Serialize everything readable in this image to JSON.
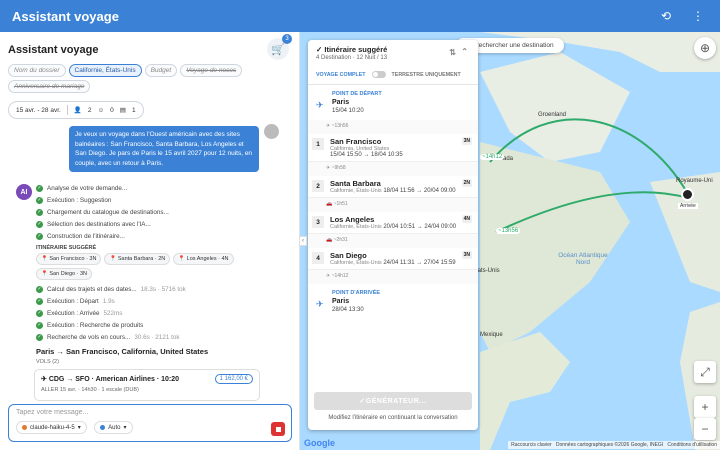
{
  "app": {
    "title": "Assistant voyage"
  },
  "left": {
    "heading": "Assistant voyage",
    "cart_count": "3",
    "chips": [
      {
        "label": "Nom du dossier",
        "state": "placeholder"
      },
      {
        "label": "Californie, États-Unis",
        "state": "selected"
      },
      {
        "label": "Budget",
        "state": "placeholder"
      },
      {
        "label": "Voyage de noces",
        "state": "struck"
      },
      {
        "label": "Anniversaire de mariage",
        "state": "struck"
      }
    ],
    "dates": "15 avr. - 28 avr.",
    "travellers": {
      "adults": "2",
      "children": "0",
      "rooms": "1"
    },
    "user_message": "Je veux un voyage dans l'Ouest américain avec des sites balnéaires : San Francisco, Santa Barbara, Los Angeles et San Diego. Je pars de Paris le 15 avril 2027 pour 12 nuits, en couple, avec un retour à Paris.",
    "ai_avatar": "AI",
    "steps_a": [
      {
        "label": "Analyse de votre demande..."
      },
      {
        "label": "Exécution : Suggestion"
      },
      {
        "label": "Chargement du catalogue de destinations..."
      },
      {
        "label": "Sélection des destinations avec l'IA..."
      },
      {
        "label": "Construction de l'itinéraire..."
      }
    ],
    "suggested_label": "ITINÉRAIRE SUGGÉRÉ",
    "pins": [
      "San Francisco · 3N",
      "Santa Barbara · 2N",
      "Los Angeles · 4N",
      "San Diego · 3N"
    ],
    "steps_b": [
      {
        "label": "Calcul des trajets et des dates...",
        "time": "18.3s · 5716 tok"
      },
      {
        "label": "Exécution : Départ",
        "time": "1.9s"
      },
      {
        "label": "Exécution : Arrivée",
        "time": "522ms"
      },
      {
        "label": "Exécution : Recherche de produits",
        "time": ""
      },
      {
        "label": "Recherche de vols en cours...",
        "time": "30.6s · 2121 tok"
      }
    ],
    "route_title": "Paris → San Francisco, California, United States",
    "vols_label": "VOLS (2)",
    "flight": {
      "title": "CDG → SFO · American Airlines · 10:20",
      "price": "1 162,00 €",
      "detail": "ALLER 15 avr. · 14h30 · 1 escale (DUB)"
    },
    "input_placeholder": "Tapez votre message...",
    "model": "claude-haiku-4-5",
    "mode": "Auto"
  },
  "map": {
    "search_placeholder": "Rechercher une destination",
    "labels": {
      "greenland": "Groenland",
      "canada": "Canada",
      "usa": "États-Unis",
      "mexico": "Mexique",
      "ocean": "Océan Atlantique Nord",
      "uk": "Royaume-Uni",
      "arrival": "Arrivée",
      "hours1": "~14h12",
      "hours2": "~13h56"
    },
    "footer": {
      "shortcuts": "Raccourcis clavier",
      "data": "Données cartographiques ©2026 Google, INEGI",
      "terms": "Conditions d'utilisation",
      "google": "Google"
    }
  },
  "panel": {
    "title": "Itinéraire suggéré",
    "subtitle": "4 Destination · 12 Nuit / 13",
    "mode_full": "VOYAGE COMPLET",
    "mode_land": "TERRESTRE UNIQUEMENT",
    "departure": {
      "label": "POINT DE DÉPART",
      "city": "Paris",
      "date": "15/04 10:20"
    },
    "arrival": {
      "label": "POINT D'ARRIVÉE",
      "city": "Paris",
      "date": "28/04 13:30"
    },
    "transits": [
      "~13h56",
      "~9h58",
      "~1h51",
      "~2h31",
      "~14h12"
    ],
    "legs": [
      {
        "num": "1",
        "city": "San Francisco",
        "sub": "California, United States",
        "dates": "15/04 15:50 → 18/04 10:35",
        "nights": "3N"
      },
      {
        "num": "2",
        "city": "Santa Barbara",
        "sub": "Californie, États-Unis",
        "dates": "18/04 11:56 → 20/04 09:00",
        "nights": "2N"
      },
      {
        "num": "3",
        "city": "Los Angeles",
        "sub": "Californie, États-Unis",
        "dates": "20/04 10:51 → 24/04 09:00",
        "nights": "4N"
      },
      {
        "num": "4",
        "city": "San Diego",
        "sub": "Californie, États-Unis",
        "dates": "24/04 11:31 → 27/04 15:59",
        "nights": "3N"
      }
    ],
    "generate": "GÉNÉRATEUR...",
    "modify": "Modifiez l'itinéraire en continuant la conversation"
  }
}
